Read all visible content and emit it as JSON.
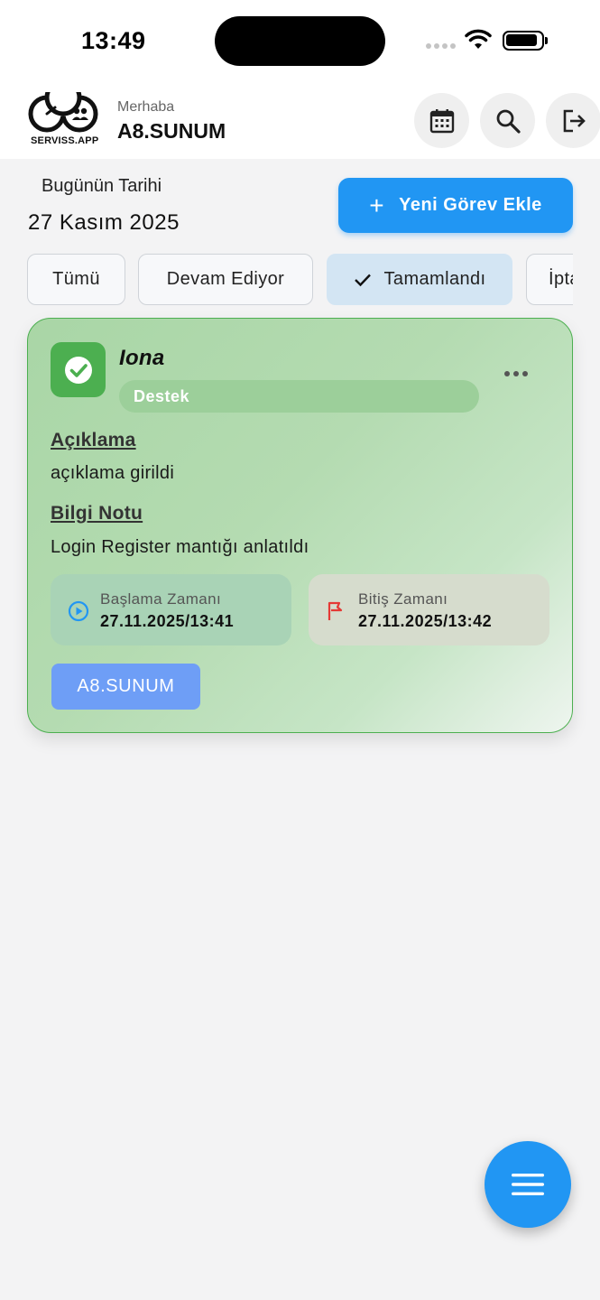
{
  "status_bar": {
    "time": "13:49"
  },
  "header": {
    "logo_text": "SERVISS.APP",
    "greeting": "Merhaba",
    "user_name": "A8.SUNUM",
    "actions": [
      "calendar-icon",
      "search-icon",
      "logout-icon"
    ]
  },
  "date_section": {
    "label": "Bugünün Tarihi",
    "value": "27 Kasım 2025"
  },
  "add_task_button": {
    "icon": "plus-icon",
    "label": "Yeni Görev Ekle"
  },
  "filters": [
    {
      "label": "Tümü",
      "selected": false
    },
    {
      "label": "Devam Ediyor",
      "selected": false
    },
    {
      "label": "Tamamlandı",
      "selected": true
    },
    {
      "label": "İptal",
      "selected": false
    }
  ],
  "task_card": {
    "title": "Iona",
    "category": "Destek",
    "status_icon": "check-icon",
    "accent_color": "#4caf50",
    "description_label": "Açıklama",
    "description": "açıklama girildi",
    "note_label": "Bilgi Notu",
    "note": "Login Register mantığı anlatıldı",
    "start": {
      "label": "Başlama Zamanı",
      "value": "27.11.2025/13:41"
    },
    "end": {
      "label": "Bitiş Zamanı",
      "value": "27.11.2025/13:42"
    },
    "assignee": "A8.SUNUM"
  },
  "fab": {
    "icon": "menu-icon"
  },
  "colors": {
    "primary": "#2196f3",
    "success": "#4caf50",
    "flag": "#e53935"
  }
}
